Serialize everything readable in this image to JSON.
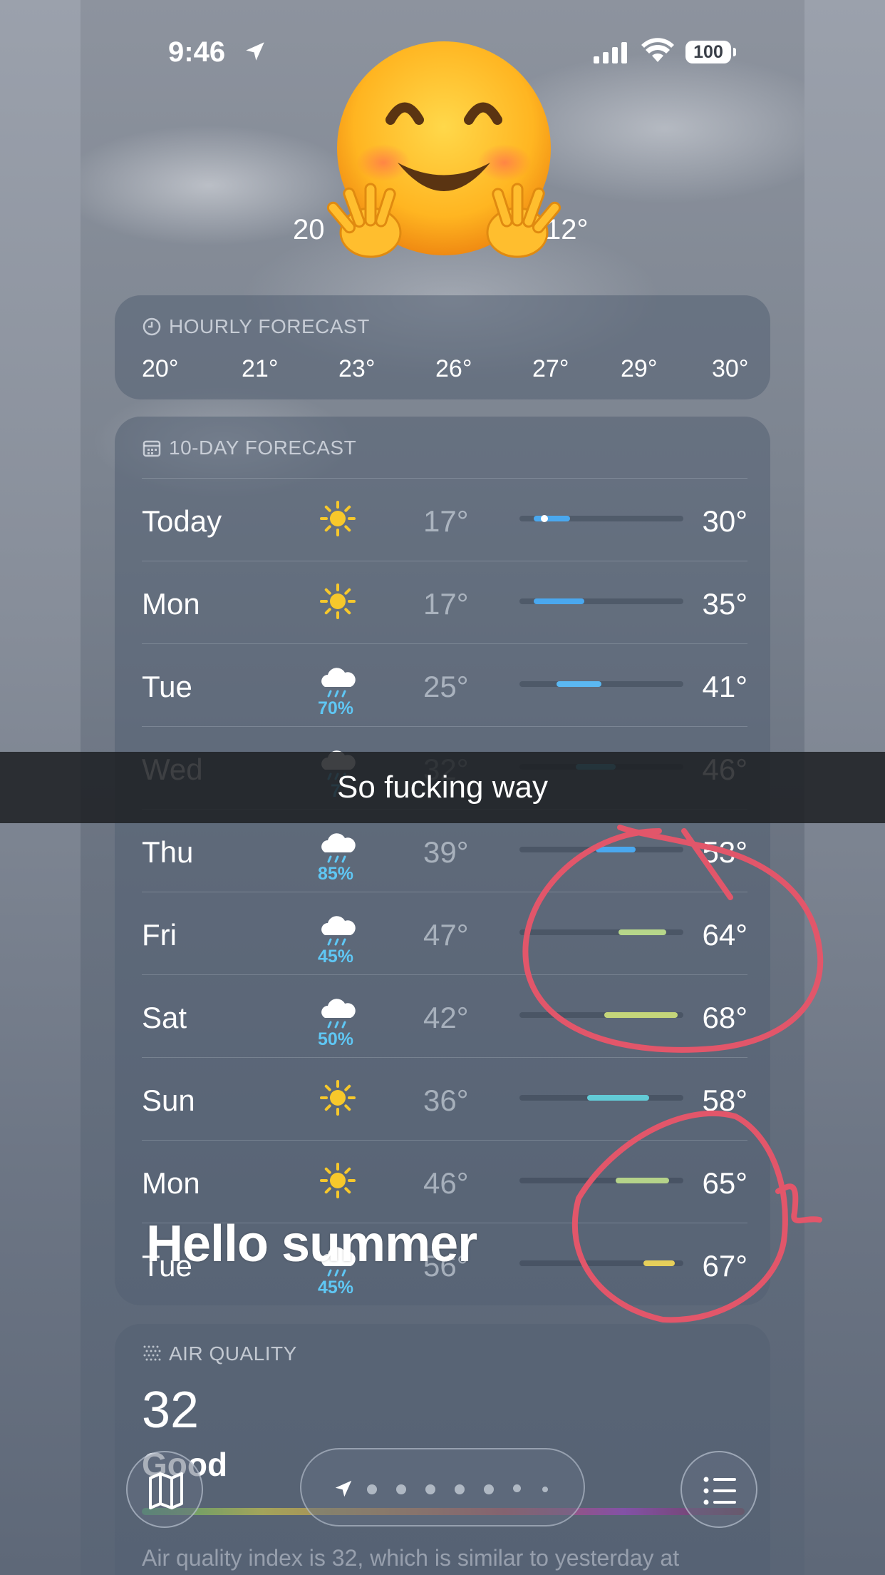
{
  "status_bar": {
    "time": "9:46",
    "battery": "100"
  },
  "current": {
    "low_fragment": "20",
    "high_fragment": "12°"
  },
  "hourly": {
    "title": "HOURLY FORECAST",
    "temps": [
      "20°",
      "21°",
      "23°",
      "26°",
      "27°",
      "29°",
      "30°"
    ]
  },
  "ten_day": {
    "title": "10-DAY FORECAST",
    "rows": [
      {
        "day": "Today",
        "icon": "sun-icon",
        "precip": "",
        "low": "17°",
        "high": "30°"
      },
      {
        "day": "Mon",
        "icon": "sun-icon",
        "precip": "",
        "low": "17°",
        "high": "35°"
      },
      {
        "day": "Tue",
        "icon": "rain-cloud-icon",
        "precip": "70%",
        "low": "25°",
        "high": "41°"
      },
      {
        "day": "Wed",
        "icon": "rain-cloud-icon",
        "precip": "7",
        "low": "32°",
        "high": "46°"
      },
      {
        "day": "Thu",
        "icon": "rain-cloud-icon",
        "precip": "85%",
        "low": "39°",
        "high": "53°"
      },
      {
        "day": "Fri",
        "icon": "rain-cloud-icon",
        "precip": "45%",
        "low": "47°",
        "high": "64°"
      },
      {
        "day": "Sat",
        "icon": "rain-cloud-icon",
        "precip": "50%",
        "low": "42°",
        "high": "68°"
      },
      {
        "day": "Sun",
        "icon": "sun-icon",
        "precip": "",
        "low": "36°",
        "high": "58°"
      },
      {
        "day": "Mon",
        "icon": "sun-icon",
        "precip": "",
        "low": "46°",
        "high": "65°"
      },
      {
        "day": "Tue",
        "icon": "rain-cloud-icon",
        "precip": "45%",
        "low": "56°",
        "high": "67°"
      }
    ],
    "range_colors": [
      "#4aa8ef",
      "#4aa8ef",
      "#5bb8f2",
      "#4fb0c8",
      "#4aa8ef",
      "#b6d68a",
      "#c4d57a",
      "#62cbd6",
      "#b5d38a",
      "#e6cf5a"
    ]
  },
  "air_quality": {
    "title": "AIR QUALITY",
    "value": "32",
    "label": "Good",
    "description": "Air quality index is 32, which is similar to yesterday at"
  },
  "overlay": {
    "caption": "So fucking way",
    "text": "Hello summer"
  }
}
